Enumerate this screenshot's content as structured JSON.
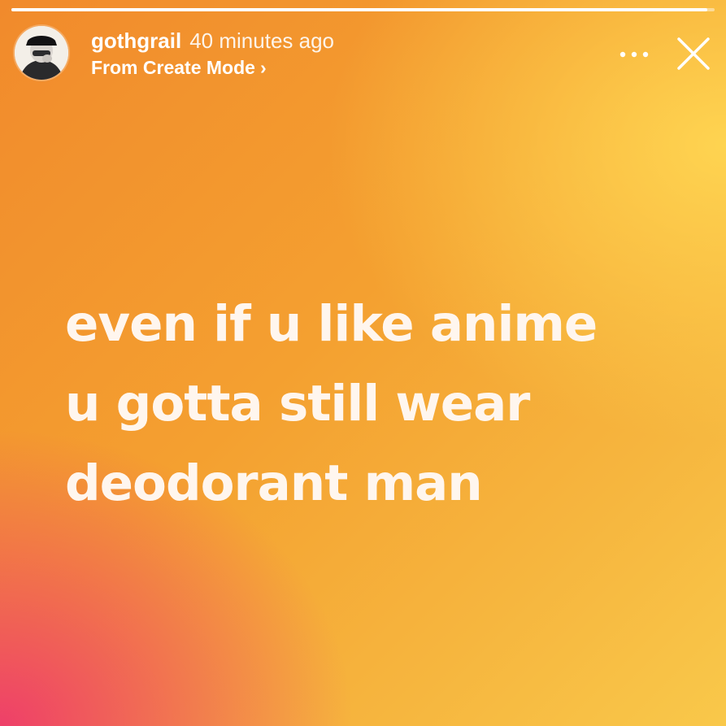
{
  "story": {
    "progress": 0.99,
    "header": {
      "username": "gothgrail",
      "time_ago": "40 minutes ago",
      "source_label": "From Create Mode",
      "source_chevron": "›"
    },
    "icons": {
      "avatar": "avatar-icon",
      "more": "more-dots-icon",
      "close": "close-icon"
    },
    "text_lines": [
      "even if u like anime",
      "u gotta still wear",
      "deodorant man"
    ],
    "colors": {
      "gradient_pink": "#ee3a6c",
      "gradient_orange": "#f18a2c",
      "gradient_yellow": "#f9c84a",
      "text": "#fff6ee"
    }
  }
}
